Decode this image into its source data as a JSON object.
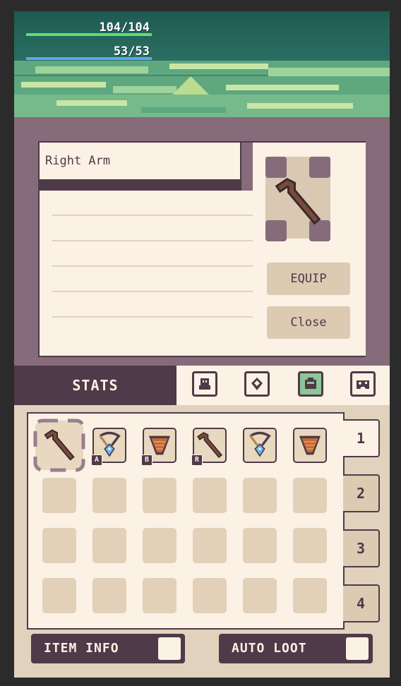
{
  "hud": {
    "hp_text": "104/104",
    "mp_text": "53/53",
    "hp_fraction": 1.0,
    "mp_fraction": 1.0,
    "hp_color": "#5fe06a",
    "mp_color": "#5aa9f0"
  },
  "detail": {
    "item_name": "Right Arm",
    "preview_icon": "staff-icon",
    "equip_label": "EQUIP",
    "close_label": "Close"
  },
  "tabs": {
    "stats_label": "STATS",
    "icons": [
      "character-icon",
      "shield-icon",
      "backpack-icon",
      "gamepad-icon"
    ],
    "active_icon": "backpack-icon"
  },
  "inventory": {
    "pages": [
      "1",
      "2",
      "3",
      "4"
    ],
    "active_page": "1",
    "items": [
      {
        "icon": "staff-icon",
        "badge": "",
        "selected": true
      },
      {
        "icon": "amulet-icon",
        "badge": "A",
        "selected": false
      },
      {
        "icon": "cape-icon",
        "badge": "B",
        "selected": false
      },
      {
        "icon": "staff-icon",
        "badge": "R",
        "selected": false
      },
      {
        "icon": "amulet-icon",
        "badge": "",
        "selected": false
      },
      {
        "icon": "cape-icon",
        "badge": "",
        "selected": false
      }
    ],
    "empty_slots": 18
  },
  "footer": {
    "item_info_label": "ITEM INFO",
    "auto_loot_label": "AUTO LOOT",
    "item_info_checked": false,
    "auto_loot_checked": false
  }
}
